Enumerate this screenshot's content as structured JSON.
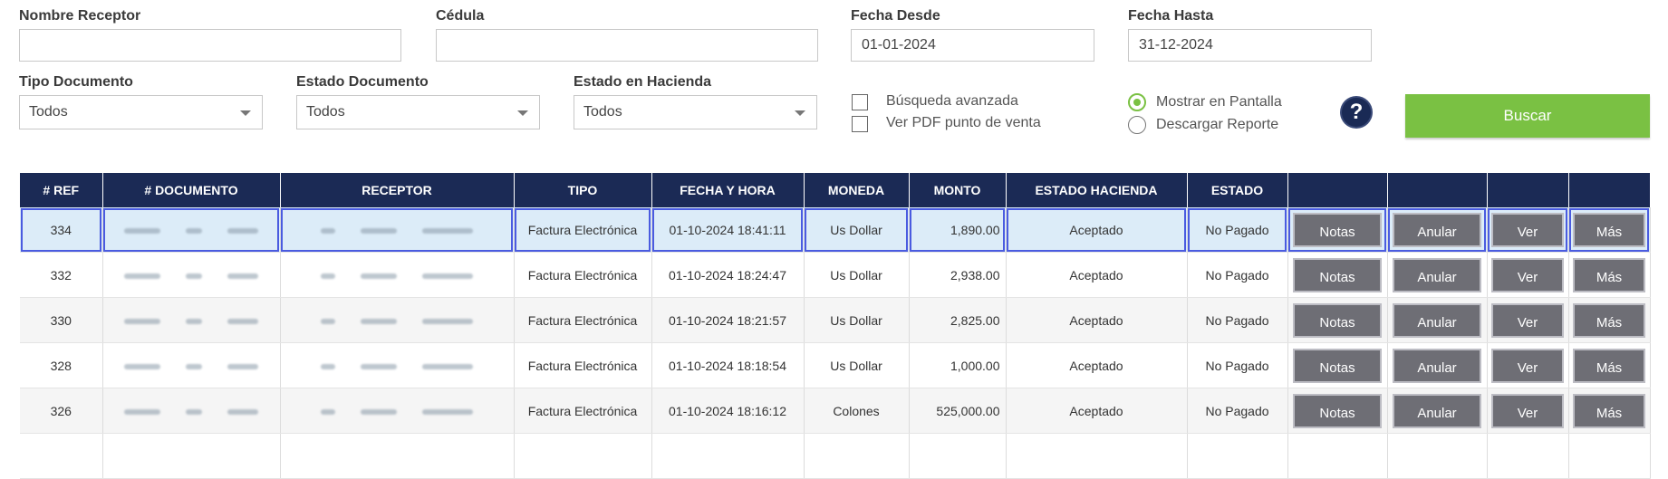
{
  "filters": {
    "nombre_receptor": {
      "label": "Nombre Receptor",
      "value": ""
    },
    "cedula": {
      "label": "Cédula",
      "value": ""
    },
    "fecha_desde": {
      "label": "Fecha Desde",
      "value": "01-01-2024"
    },
    "fecha_hasta": {
      "label": "Fecha Hasta",
      "value": "31-12-2024"
    },
    "tipo_documento": {
      "label": "Tipo Documento",
      "value": "Todos"
    },
    "estado_documento": {
      "label": "Estado Documento",
      "value": "Todos"
    },
    "estado_hacienda": {
      "label": "Estado en Hacienda",
      "value": "Todos"
    },
    "busqueda_avanzada": "Búsqueda avanzada",
    "ver_pdf": "Ver PDF punto de venta",
    "mostrar_pantalla": "Mostrar en Pantalla",
    "descargar_reporte": "Descargar Reporte",
    "help_glyph": "?",
    "buscar": "Buscar"
  },
  "table": {
    "headers": [
      "# REF",
      "# DOCUMENTO",
      "RECEPTOR",
      "TIPO",
      "FECHA Y HORA",
      "MONEDA",
      "MONTO",
      "ESTADO HACIENDA",
      "ESTADO"
    ],
    "action_labels": {
      "notas": "Notas",
      "anular": "Anular",
      "ver": "Ver",
      "mas": "Más"
    },
    "rows": [
      {
        "ref": "334",
        "tipo": "Factura Electrónica",
        "fecha": "01-10-2024 18:41:11",
        "moneda": "Us Dollar",
        "monto": "1,890.00",
        "hacienda": "Aceptado",
        "estado": "No Pagado"
      },
      {
        "ref": "332",
        "tipo": "Factura Electrónica",
        "fecha": "01-10-2024 18:24:47",
        "moneda": "Us Dollar",
        "monto": "2,938.00",
        "hacienda": "Aceptado",
        "estado": "No Pagado"
      },
      {
        "ref": "330",
        "tipo": "Factura Electrónica",
        "fecha": "01-10-2024 18:21:57",
        "moneda": "Us Dollar",
        "monto": "2,825.00",
        "hacienda": "Aceptado",
        "estado": "No Pagado"
      },
      {
        "ref": "328",
        "tipo": "Factura Electrónica",
        "fecha": "01-10-2024 18:18:54",
        "moneda": "Us Dollar",
        "monto": "1,000.00",
        "hacienda": "Aceptado",
        "estado": "No Pagado"
      },
      {
        "ref": "326",
        "tipo": "Factura Electrónica",
        "fecha": "01-10-2024 18:16:12",
        "moneda": "Colones",
        "monto": "525,000.00",
        "hacienda": "Aceptado",
        "estado": "No Pagado"
      }
    ]
  },
  "colors": {
    "header_bg": "#1b2a55",
    "accent_green": "#7ac143",
    "action_btn": "#6e6e75"
  }
}
